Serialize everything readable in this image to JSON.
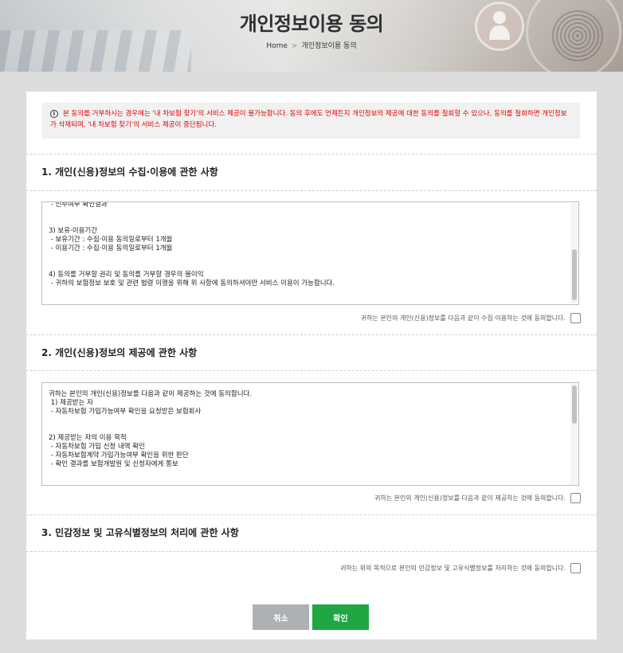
{
  "header": {
    "title": "개인정보이용 동의",
    "breadcrumb": {
      "home": "Home",
      "separator": ">",
      "current": "개인정보이용 동의"
    }
  },
  "notice": {
    "text": "본 동의를 거부하시는 경우에는 '내 차보험 찾기'의 서비스 제공이 불가능합니다. 동의 후에도 언제든지 개인정보의 제공에 대한 동의를 철회할 수 있으나, 동의를 철회하면 개인정보가 삭제되며, '내 차보험 찾기'의 서비스 제공이 중단됩니다."
  },
  "sections": [
    {
      "title": "1. 개인(신용)정보의 수집·이용에 관한 사항",
      "content": [
        " - 인수여부 확인결과",
        "",
        "",
        "3) 보유·이용기간",
        " - 보유기간 : 수집·이용 동의일로부터 1개월",
        " - 이용기간 : 수집·이용 동의일로부터 1개월",
        "",
        "",
        "4) 동의를 거부할 권리 및 동의를 거부할 경우의 불이익",
        " - 귀하의 보험정보 보호 및 관련 법령 이행을 위해 위 사항에 동의하셔야만 서비스 이용이 가능합니다."
      ],
      "agree_text": "귀하는 본인의 개인(신용)정보를 다음과 같이 수집·이용하는 것에 동의합니다.",
      "checked": false
    },
    {
      "title": "2. 개인(신용)정보의 제공에 관한 사항",
      "content": [
        "귀하는 본인의 개인(신용)정보를 다음과 같이 제공하는 것에 동의합니다.",
        " 1) 제공받는 자",
        " - 자동차보험 가입가능여부 확인을 요청받은 보험회사",
        "",
        "",
        "2) 제공받는 자의 이용 목적",
        " - 자동차보험 가입 신청 내역 확인",
        " - 자동차보험계약 가입가능여부 확인을 위한 판단",
        " - 확인 결과를 보험개발원 및 신청자에게 통보"
      ],
      "agree_text": "귀하는 본인의 개인(신용)정보를 다음과 같이 제공하는 것에 동의합니다.",
      "checked": false
    },
    {
      "title": "3. 민감정보 및 고유식별정보의 처리에 관한 사항",
      "agree_text": "귀하는 위의 목적으로 본인의 민감정보 및 고유식별정보를 처리하는 것에 동의합니다.",
      "checked": false
    }
  ],
  "buttons": {
    "cancel": "취소",
    "confirm": "확인"
  },
  "colors": {
    "notice_text": "#e00000",
    "confirm": "#1ea743",
    "cancel": "#aeb1b4"
  }
}
